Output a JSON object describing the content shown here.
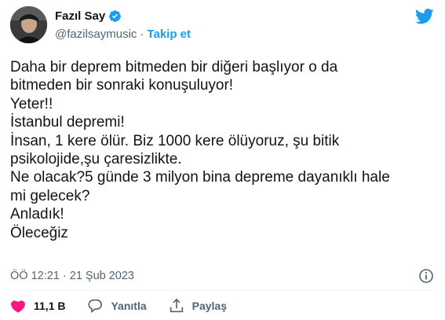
{
  "colors": {
    "brand": "#1d9bf0",
    "text": "#0f1419",
    "muted": "#536471",
    "like": "#f91880"
  },
  "user": {
    "display_name": "Fazıl Say",
    "handle": "@fazilsaymusic",
    "separator": "·",
    "follow_label": "Takip et",
    "verified_icon": "verified-badge-icon"
  },
  "tweet": {
    "lines": [
      "Daha bir deprem bitmeden bir diğeri başlıyor o da",
      "bitmeden bir sonraki konuşuluyor!",
      "Yeter!!",
      "İstanbul depremi!",
      "İnsan, 1 kere ölür. Biz 1000 kere ölüyoruz, şu bitik",
      "psikolojide,şu çaresizlikte.",
      "Ne olacak?5 günde 3 milyon bina depreme dayanıklı hale",
      "mi gelecek?",
      "Anladık!",
      "Öleceğiz"
    ]
  },
  "meta": {
    "timestamp": "ÖÖ 12:21 · 21 Şub 2023"
  },
  "actions": {
    "like_count": "11,1 B",
    "reply_label": "Yanıtla",
    "share_label": "Paylaş"
  }
}
